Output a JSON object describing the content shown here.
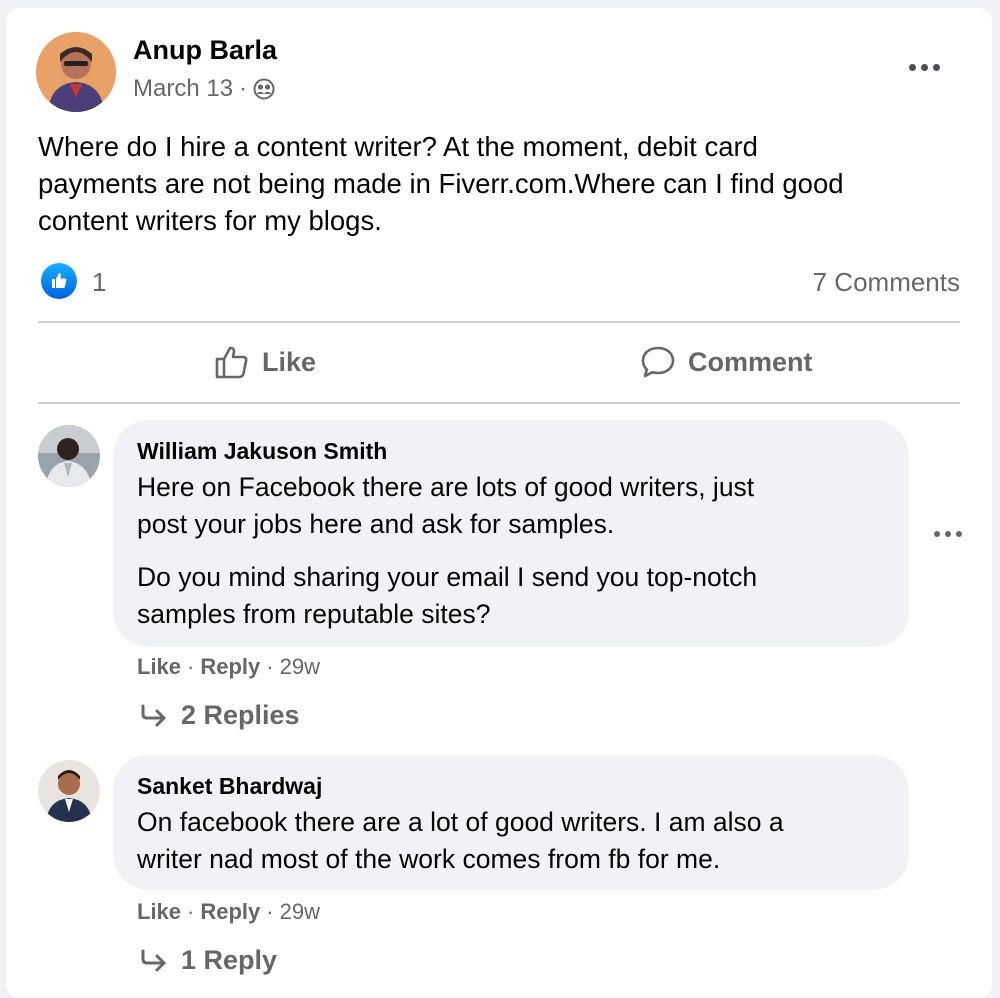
{
  "post": {
    "author": "Anup Barla",
    "date": "March 13",
    "separator": "·",
    "privacy_icon": "friends-icon",
    "text_line1": "Where do I hire a content writer? At the moment, debit card",
    "text_line2": "payments are not being made in Fiverr.com.Where can I find good",
    "text_line3": "content writers for my blogs.",
    "reaction_count": "1",
    "comments_count": "7 Comments",
    "like_label": "Like",
    "comment_label": "Comment"
  },
  "comments": [
    {
      "name": "William Jakuson Smith",
      "line1": "Here on Facebook there are lots of good writers, just",
      "line2": "post your jobs here and ask for samples.",
      "line3": "Do you mind sharing your email I send you top-notch",
      "line4": "samples from reputable sites?",
      "like": "Like",
      "reply": "Reply",
      "time": "29w",
      "replies": "2 Replies"
    },
    {
      "name": "Sanket Bhardwaj",
      "line1": "On facebook there are a lot of good writers. I am also a",
      "line2": "writer nad most of the work comes from fb for me.",
      "like": "Like",
      "reply": "Reply",
      "time": "29w",
      "replies": "1 Reply"
    }
  ],
  "dot_separator": "·",
  "colors": {
    "facebook_blue": "#1877f2",
    "secondary_text": "#65676b",
    "bubble_bg": "#f0f2f5"
  }
}
